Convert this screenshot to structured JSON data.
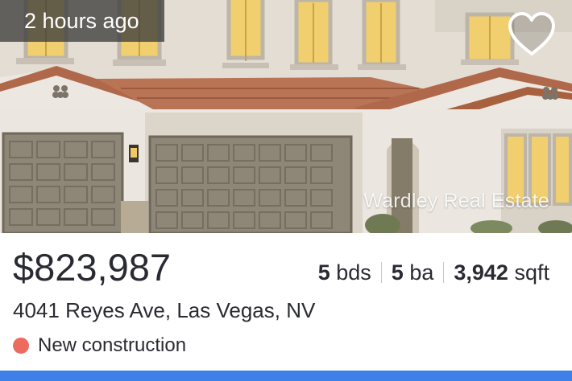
{
  "listing": {
    "age_badge": "2 hours ago",
    "watermark": "Wardley Real Estate",
    "price": "$823,987",
    "beds": "5",
    "beds_unit": "bds",
    "baths": "5",
    "baths_unit": "ba",
    "sqft": "3,942",
    "sqft_unit": "sqft",
    "address": "4041 Reyes Ave, Las Vegas, NV",
    "status": "New construction",
    "favorite_icon": "heart-outline-icon",
    "status_color": "#ec6b5e",
    "accent_color": "#3f7fe8"
  }
}
